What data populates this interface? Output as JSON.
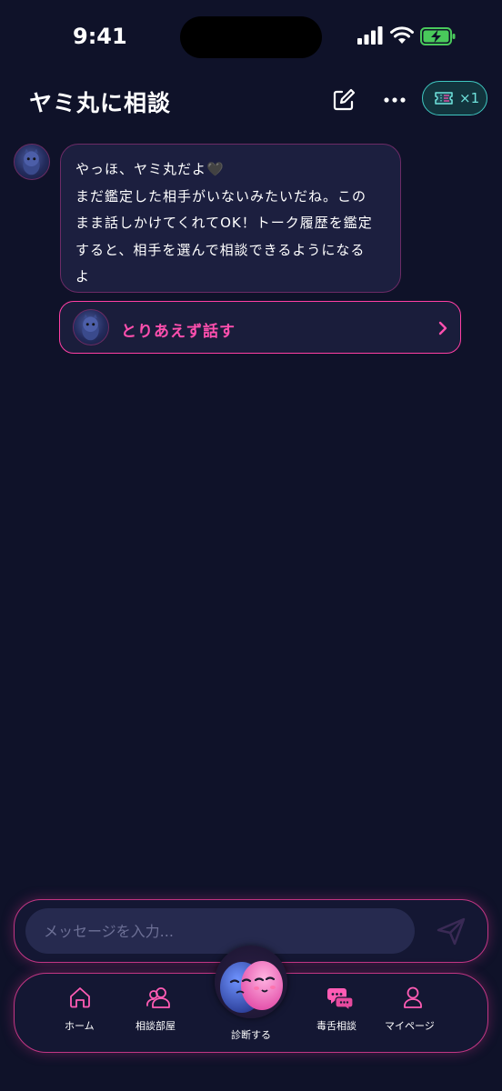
{
  "status_bar": {
    "time": "9:41"
  },
  "header": {
    "title": "ヤミ丸に相談",
    "ticket_count": "×1"
  },
  "chat": {
    "message_lines": [
      "やっほ、ヤミ丸だよ🖤",
      "まだ鑑定した相手がいないみたいだね。この",
      "まま話しかけてくれてOK！トーク履歴を鑑定",
      "すると、相手を選んで相談できるようになる",
      "よ"
    ],
    "action_label": "とりあえず話す"
  },
  "composer": {
    "placeholder": "メッセージを入力..."
  },
  "nav": {
    "home": "ホーム",
    "rooms": "相談部屋",
    "diagnose": "診断する",
    "roast": "毒舌相談",
    "mypage": "マイページ"
  },
  "colors": {
    "background": "#0f1229",
    "accent_pink": "#ff3fa4",
    "accent_teal": "#3fc7c0",
    "bubble": "#1c1f3f"
  },
  "icons": {
    "edit": "edit-icon",
    "more": "more-icon",
    "ticket": "ticket-icon",
    "send": "send-icon",
    "home": "home-icon",
    "rooms": "users-icon",
    "roast": "chat-bubbles-icon",
    "mypage": "person-icon"
  }
}
